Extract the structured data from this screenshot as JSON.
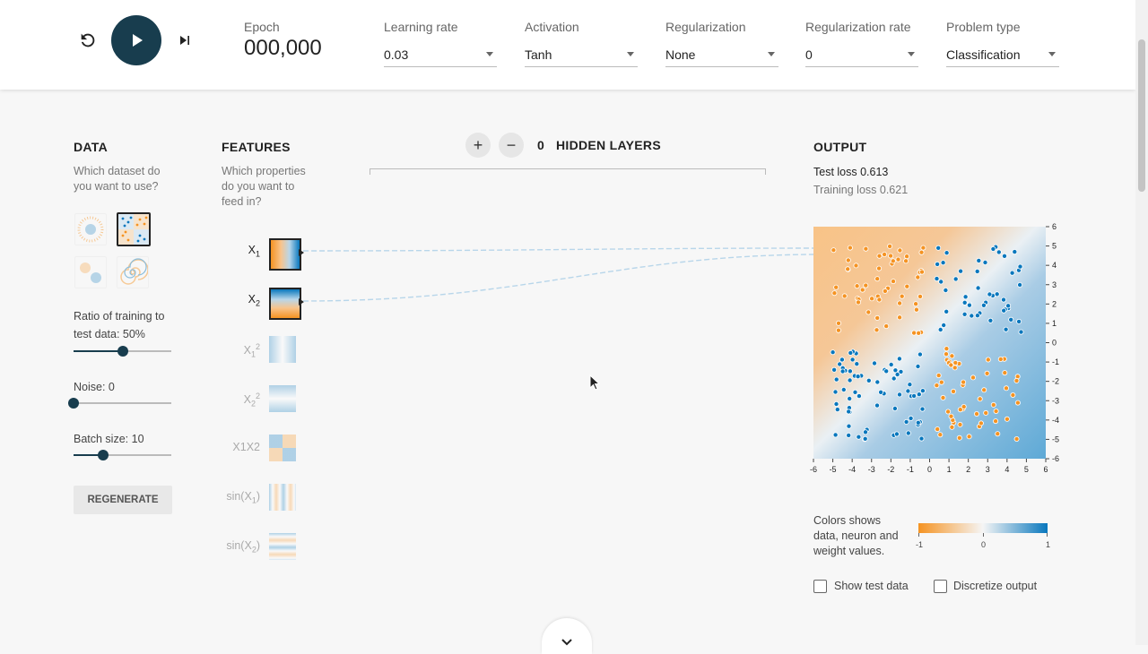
{
  "controls": {
    "epoch_label": "Epoch",
    "epoch_value": "000,000",
    "dropdowns": [
      {
        "label": "Learning rate",
        "value": "0.03"
      },
      {
        "label": "Activation",
        "value": "Tanh"
      },
      {
        "label": "Regularization",
        "value": "None"
      },
      {
        "label": "Regularization rate",
        "value": "0"
      },
      {
        "label": "Problem type",
        "value": "Classification"
      }
    ]
  },
  "data_panel": {
    "title": "DATA",
    "subtitle_line1": "Which dataset do",
    "subtitle_line2": "you want to use?",
    "ratio_line1": "Ratio of training to",
    "ratio_line2": "test data:  50%",
    "ratio_value": 0.5,
    "noise_label": "Noise:  0",
    "noise_value": 0,
    "batch_label": "Batch size:  10",
    "batch_value": 0.3,
    "regenerate_label": "REGENERATE"
  },
  "features_panel": {
    "title": "FEATURES",
    "subtitle_line1": "Which properties",
    "subtitle_line2": "do you want to",
    "subtitle_line3": "feed in?",
    "features": [
      {
        "label": "X",
        "sub": "1",
        "active": true
      },
      {
        "label": "X",
        "sub": "2",
        "active": true
      },
      {
        "label": "X",
        "sub": "1",
        "sup": "2",
        "active": false
      },
      {
        "label": "X",
        "sub": "2",
        "sup": "2",
        "active": false
      },
      {
        "label": "X1X2",
        "active": false
      },
      {
        "label": "sin(X",
        "sub": "1",
        "suffix": ")",
        "active": false
      },
      {
        "label": "sin(X",
        "sub": "2",
        "suffix": ")",
        "active": false
      }
    ]
  },
  "network": {
    "add_icon": "+",
    "remove_icon": "−",
    "hidden_count": "0",
    "hidden_label": "HIDDEN LAYERS"
  },
  "output_panel": {
    "title": "OUTPUT",
    "test_loss": "Test loss 0.613",
    "training_loss": "Training loss 0.621",
    "legend_line1": "Colors shows",
    "legend_line2": "data, neuron and",
    "legend_line3": "weight values.",
    "legend_min": "-1",
    "legend_mid": "0",
    "legend_max": "1",
    "show_test_label": "Show test data",
    "discretize_label": "Discretize output",
    "x_ticks": [
      "-6",
      "-5",
      "-4",
      "-3",
      "-2",
      "-1",
      "0",
      "1",
      "2",
      "3",
      "4",
      "5",
      "6"
    ],
    "y_ticks": [
      "6",
      "5",
      "4",
      "3",
      "2",
      "1",
      "0",
      "-1",
      "-2",
      "-3",
      "-4",
      "-5",
      "-6"
    ],
    "color_negative": "#f59322",
    "color_positive": "#0877bd"
  }
}
